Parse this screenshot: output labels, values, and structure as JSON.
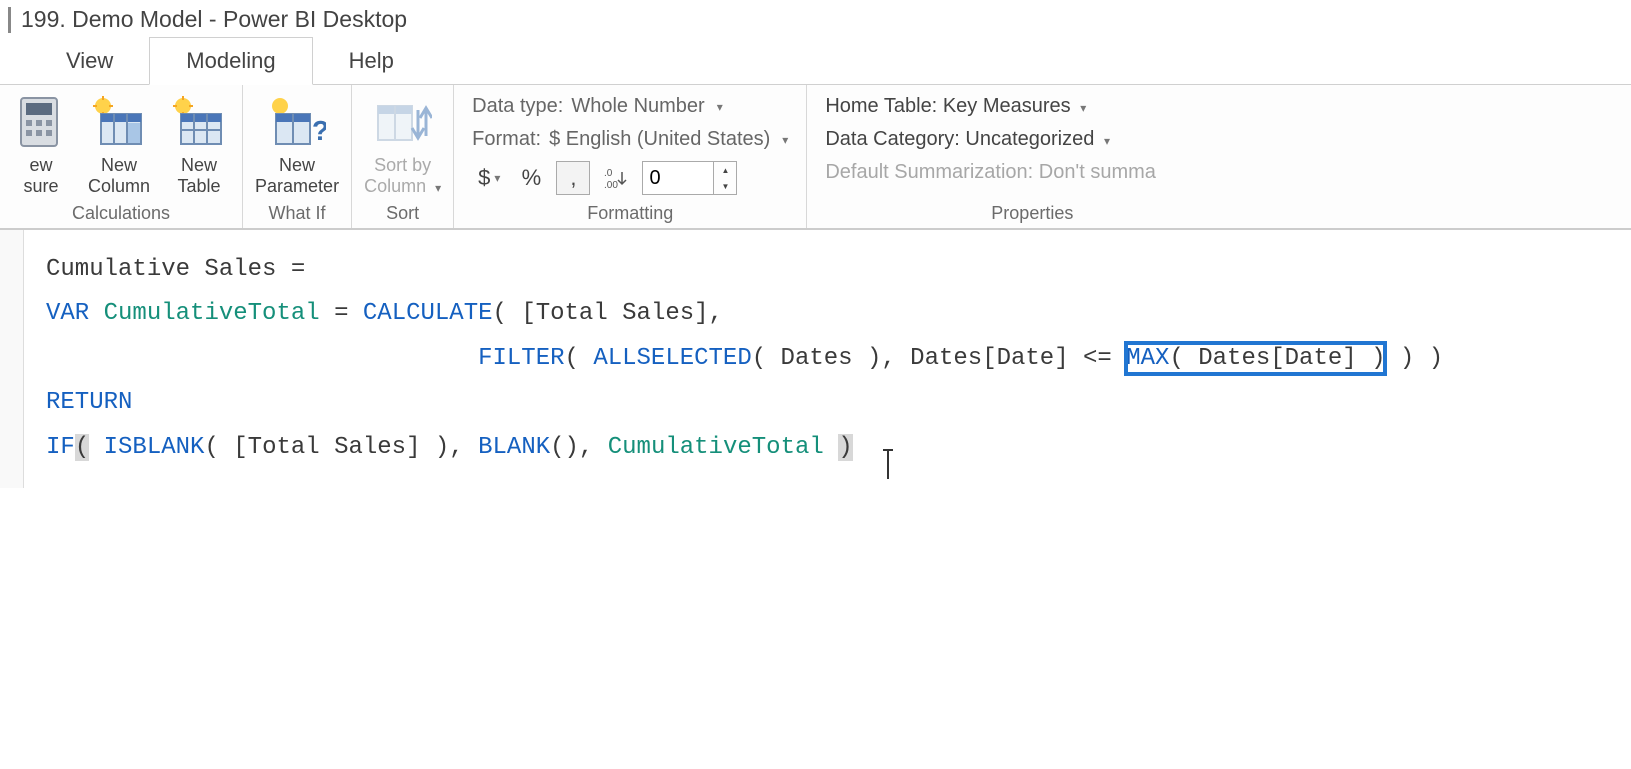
{
  "title": "199. Demo Model - Power BI Desktop",
  "tabs": {
    "view": "View",
    "modeling": "Modeling",
    "help": "Help"
  },
  "ribbon": {
    "calculations": {
      "label": "Calculations",
      "new_measure": "ew\nsure",
      "new_column": "New\nColumn",
      "new_table": "New\nTable"
    },
    "whatif": {
      "label": "What If",
      "new_parameter": "New\nParameter"
    },
    "sort": {
      "label": "Sort",
      "sort_by_column": "Sort by\nColumn"
    },
    "formatting": {
      "label": "Formatting",
      "data_type_label": "Data type:",
      "data_type_value": "Whole Number",
      "format_label": "Format:",
      "format_value": "$ English (United States)",
      "currency": "$",
      "percent": "%",
      "thousands": ",",
      "decimal_icon": ".00",
      "decimals_value": "0"
    },
    "properties": {
      "label": "Properties",
      "home_table_label": "Home Table:",
      "home_table_value": "Key Measures",
      "data_category_label": "Data Category:",
      "data_category_value": "Uncategorized",
      "default_summ": "Default Summarization: Don't summa"
    }
  },
  "formula": {
    "line1_a": "Cumulative Sales = ",
    "line2_var": "VAR",
    "line2_name": "CumulativeTotal",
    "line2_eq": " = ",
    "line2_calc": "CALCULATE",
    "line2_ts": "( [Total Sales],",
    "line3_pad": "                              ",
    "line3_filter": "FILTER",
    "line3_p1": "( ",
    "line3_allsel": "ALLSELECTED",
    "line3_p2": "( Dates ), Dates[Date] <= ",
    "line3_max": "MAX",
    "line3_maxarg": "( Dates[Date] )",
    "line3_tail": " ) )",
    "line4_return": "RETURN",
    "line5_if": "IF",
    "line5_p1": "(",
    "line5_mid": " ",
    "line5_isblank": "ISBLANK",
    "line5_arg": "( [Total Sales] ), ",
    "line5_blank": "BLANK",
    "line5_bp": "(), ",
    "line5_ct": "CumulativeTotal",
    "line5_close": ")"
  }
}
